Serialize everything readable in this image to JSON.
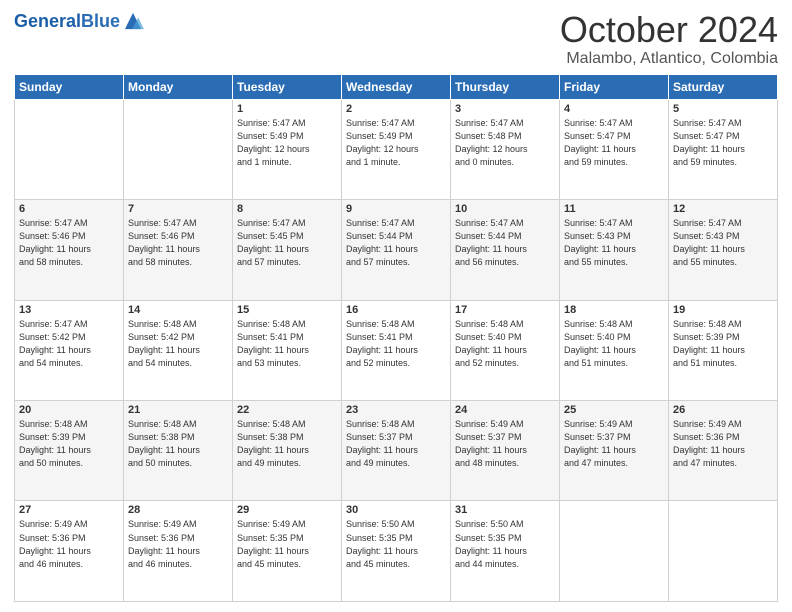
{
  "header": {
    "logo_general": "General",
    "logo_blue": "Blue",
    "title": "October 2024",
    "subtitle": "Malambo, Atlantico, Colombia"
  },
  "calendar": {
    "weekdays": [
      "Sunday",
      "Monday",
      "Tuesday",
      "Wednesday",
      "Thursday",
      "Friday",
      "Saturday"
    ],
    "weeks": [
      [
        {
          "day": "",
          "info": ""
        },
        {
          "day": "",
          "info": ""
        },
        {
          "day": "1",
          "info": "Sunrise: 5:47 AM\nSunset: 5:49 PM\nDaylight: 12 hours\nand 1 minute."
        },
        {
          "day": "2",
          "info": "Sunrise: 5:47 AM\nSunset: 5:49 PM\nDaylight: 12 hours\nand 1 minute."
        },
        {
          "day": "3",
          "info": "Sunrise: 5:47 AM\nSunset: 5:48 PM\nDaylight: 12 hours\nand 0 minutes."
        },
        {
          "day": "4",
          "info": "Sunrise: 5:47 AM\nSunset: 5:47 PM\nDaylight: 11 hours\nand 59 minutes."
        },
        {
          "day": "5",
          "info": "Sunrise: 5:47 AM\nSunset: 5:47 PM\nDaylight: 11 hours\nand 59 minutes."
        }
      ],
      [
        {
          "day": "6",
          "info": "Sunrise: 5:47 AM\nSunset: 5:46 PM\nDaylight: 11 hours\nand 58 minutes."
        },
        {
          "day": "7",
          "info": "Sunrise: 5:47 AM\nSunset: 5:46 PM\nDaylight: 11 hours\nand 58 minutes."
        },
        {
          "day": "8",
          "info": "Sunrise: 5:47 AM\nSunset: 5:45 PM\nDaylight: 11 hours\nand 57 minutes."
        },
        {
          "day": "9",
          "info": "Sunrise: 5:47 AM\nSunset: 5:44 PM\nDaylight: 11 hours\nand 57 minutes."
        },
        {
          "day": "10",
          "info": "Sunrise: 5:47 AM\nSunset: 5:44 PM\nDaylight: 11 hours\nand 56 minutes."
        },
        {
          "day": "11",
          "info": "Sunrise: 5:47 AM\nSunset: 5:43 PM\nDaylight: 11 hours\nand 55 minutes."
        },
        {
          "day": "12",
          "info": "Sunrise: 5:47 AM\nSunset: 5:43 PM\nDaylight: 11 hours\nand 55 minutes."
        }
      ],
      [
        {
          "day": "13",
          "info": "Sunrise: 5:47 AM\nSunset: 5:42 PM\nDaylight: 11 hours\nand 54 minutes."
        },
        {
          "day": "14",
          "info": "Sunrise: 5:48 AM\nSunset: 5:42 PM\nDaylight: 11 hours\nand 54 minutes."
        },
        {
          "day": "15",
          "info": "Sunrise: 5:48 AM\nSunset: 5:41 PM\nDaylight: 11 hours\nand 53 minutes."
        },
        {
          "day": "16",
          "info": "Sunrise: 5:48 AM\nSunset: 5:41 PM\nDaylight: 11 hours\nand 52 minutes."
        },
        {
          "day": "17",
          "info": "Sunrise: 5:48 AM\nSunset: 5:40 PM\nDaylight: 11 hours\nand 52 minutes."
        },
        {
          "day": "18",
          "info": "Sunrise: 5:48 AM\nSunset: 5:40 PM\nDaylight: 11 hours\nand 51 minutes."
        },
        {
          "day": "19",
          "info": "Sunrise: 5:48 AM\nSunset: 5:39 PM\nDaylight: 11 hours\nand 51 minutes."
        }
      ],
      [
        {
          "day": "20",
          "info": "Sunrise: 5:48 AM\nSunset: 5:39 PM\nDaylight: 11 hours\nand 50 minutes."
        },
        {
          "day": "21",
          "info": "Sunrise: 5:48 AM\nSunset: 5:38 PM\nDaylight: 11 hours\nand 50 minutes."
        },
        {
          "day": "22",
          "info": "Sunrise: 5:48 AM\nSunset: 5:38 PM\nDaylight: 11 hours\nand 49 minutes."
        },
        {
          "day": "23",
          "info": "Sunrise: 5:48 AM\nSunset: 5:37 PM\nDaylight: 11 hours\nand 49 minutes."
        },
        {
          "day": "24",
          "info": "Sunrise: 5:49 AM\nSunset: 5:37 PM\nDaylight: 11 hours\nand 48 minutes."
        },
        {
          "day": "25",
          "info": "Sunrise: 5:49 AM\nSunset: 5:37 PM\nDaylight: 11 hours\nand 47 minutes."
        },
        {
          "day": "26",
          "info": "Sunrise: 5:49 AM\nSunset: 5:36 PM\nDaylight: 11 hours\nand 47 minutes."
        }
      ],
      [
        {
          "day": "27",
          "info": "Sunrise: 5:49 AM\nSunset: 5:36 PM\nDaylight: 11 hours\nand 46 minutes."
        },
        {
          "day": "28",
          "info": "Sunrise: 5:49 AM\nSunset: 5:36 PM\nDaylight: 11 hours\nand 46 minutes."
        },
        {
          "day": "29",
          "info": "Sunrise: 5:49 AM\nSunset: 5:35 PM\nDaylight: 11 hours\nand 45 minutes."
        },
        {
          "day": "30",
          "info": "Sunrise: 5:50 AM\nSunset: 5:35 PM\nDaylight: 11 hours\nand 45 minutes."
        },
        {
          "day": "31",
          "info": "Sunrise: 5:50 AM\nSunset: 5:35 PM\nDaylight: 11 hours\nand 44 minutes."
        },
        {
          "day": "",
          "info": ""
        },
        {
          "day": "",
          "info": ""
        }
      ]
    ]
  }
}
